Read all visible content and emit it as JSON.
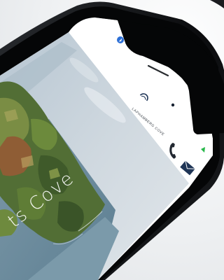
{
  "app": {
    "brand_name": "LAPHAMBERG COVE",
    "hero_title": "ts Cove"
  },
  "icons": {
    "location": "location-arrow-icon",
    "logo": "cove-logo-icon",
    "phone": "phone-icon",
    "mail": "envelope-icon",
    "status": "green-status-icon"
  },
  "colors": {
    "phone_frame": "#0d0f12",
    "header_bg": "#ffffff",
    "accent_blue": "#2c6fd6",
    "brand_navy": "#1f3556",
    "status_green": "#28b84a",
    "sky": "#c8d3dc",
    "sea": "#6f8fa0",
    "land": "#4f6e35"
  }
}
